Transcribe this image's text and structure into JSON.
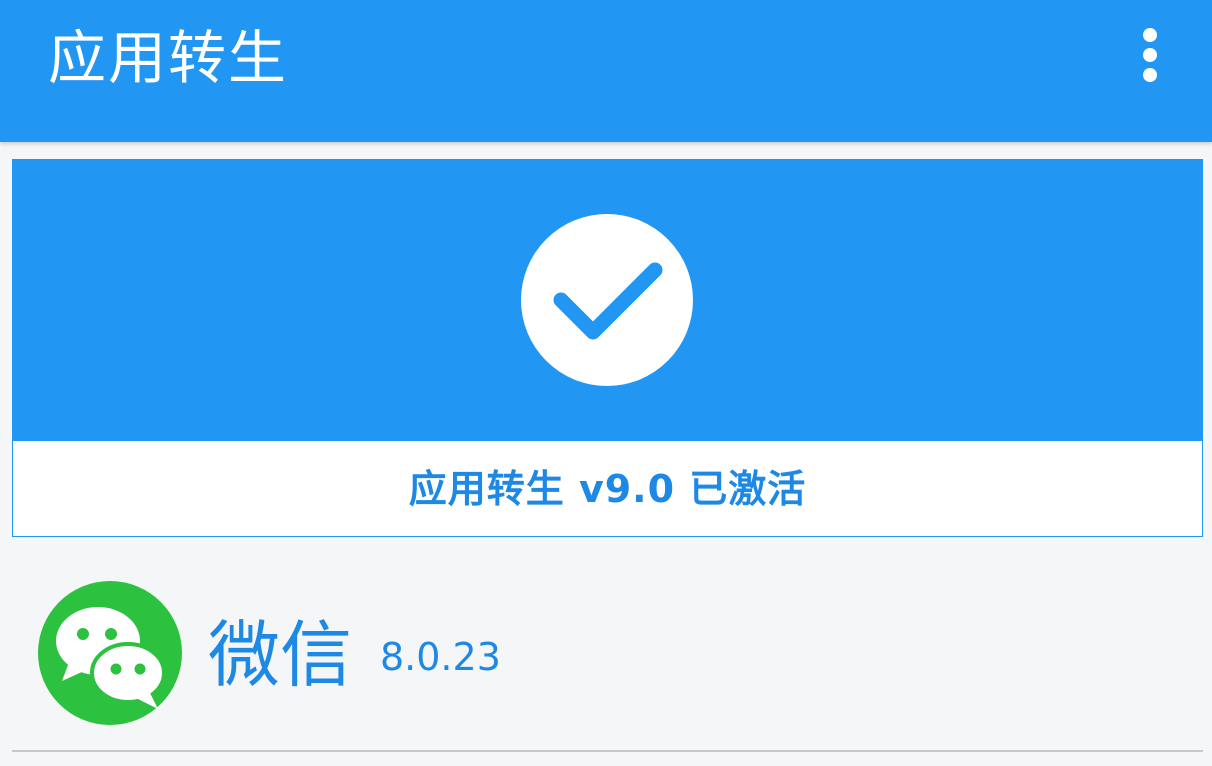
{
  "app_bar": {
    "title": "应用转生",
    "overflow_icon": "more-vert-icon"
  },
  "status_card": {
    "icon": "check-circle-icon",
    "text": "应用转生 v9.0 已激活"
  },
  "app_list": [
    {
      "name": "微信",
      "version": "8.0.23",
      "icon": "wechat-icon"
    }
  ],
  "colors": {
    "primary": "#2196f3",
    "text_accent": "#1e88e5",
    "wechat_green": "#2dc140",
    "background": "#f5f6f8"
  }
}
